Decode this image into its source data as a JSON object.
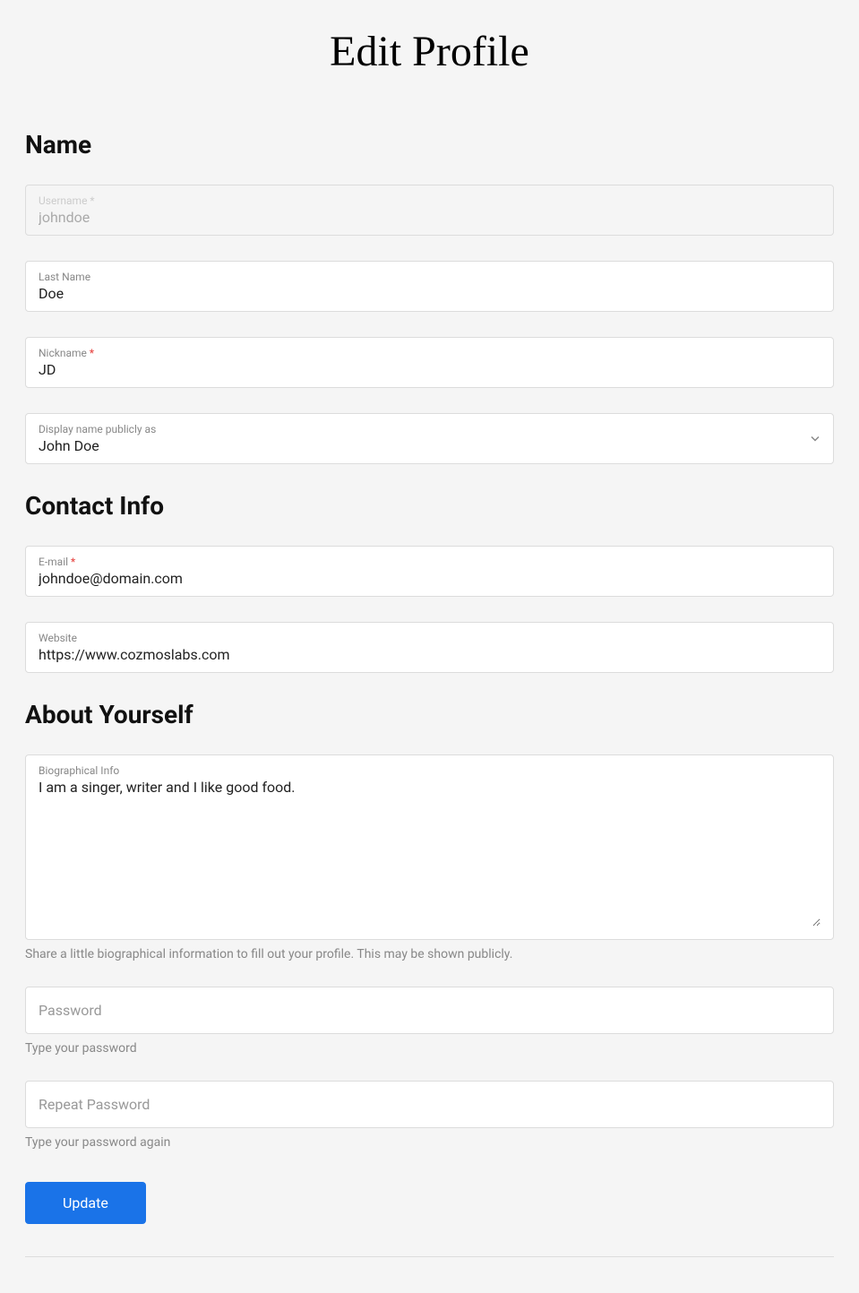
{
  "page": {
    "title": "Edit Profile"
  },
  "sections": {
    "name": {
      "title": "Name",
      "username": {
        "label": "Username",
        "value": "johndoe"
      },
      "last_name": {
        "label": "Last Name",
        "value": "Doe"
      },
      "nickname": {
        "label": "Nickname",
        "value": "JD"
      },
      "display_name": {
        "label": "Display name publicly as",
        "value": "John Doe"
      }
    },
    "contact": {
      "title": "Contact Info",
      "email": {
        "label": "E-mail",
        "value": "johndoe@domain.com"
      },
      "website": {
        "label": "Website",
        "value": "https://www.cozmoslabs.com"
      }
    },
    "about": {
      "title": "About Yourself",
      "bio": {
        "label": "Biographical Info",
        "value": "I am a singer, writer and I like good food.",
        "help": "Share a little biographical information to fill out your profile. This may be shown publicly."
      },
      "password": {
        "placeholder": "Password",
        "help": "Type your password"
      },
      "repeat_password": {
        "placeholder": "Repeat Password",
        "help": "Type your password again"
      }
    }
  },
  "actions": {
    "submit": "Update"
  }
}
